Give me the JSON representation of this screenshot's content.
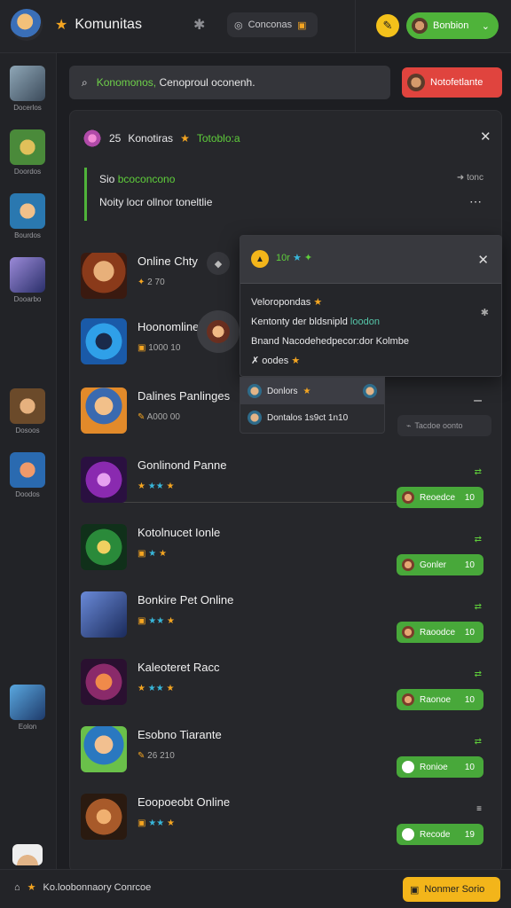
{
  "header": {
    "title": "Komunitas",
    "chip_label": "Conconas",
    "user_label": "Bonbion"
  },
  "search": {
    "highlight": "Konomonos,",
    "text": "Cenoproul oconenh."
  },
  "notif_button": {
    "label": "Notofetlante"
  },
  "panel": {
    "head_count": "25",
    "head_title": "Konotiras",
    "head_green": "Totoblo:a",
    "notice_prefix": "Sio",
    "notice_green": "bcoconcono",
    "notice_right": "tonc",
    "notice_line2": "Noity locr ollnor toneltlie"
  },
  "popup": {
    "title": "10r",
    "line1": "Veloropondas",
    "line2_prefix": "Kentonty der bldsnipld",
    "line2_green": "loodon",
    "line3": "Bnand Nacodehedpecor:dor Kolmbe",
    "line4": "oodes",
    "sub1": "Donlors",
    "sub2": "Dontalos 1s9ct 1n10"
  },
  "tag_gray": {
    "label": "Tacdoe oonto"
  },
  "rows": [
    {
      "title": "Online Chty",
      "meta": "2 70"
    },
    {
      "title": "Hoonomline",
      "meta": "1000 10"
    },
    {
      "title": "Dalines Panlinges",
      "meta": "A000 00"
    },
    {
      "title": "Gonlinond Panne",
      "pill": "Reoedce",
      "pill_num": "10"
    },
    {
      "title": "Kotolnucet Ionle",
      "pill": "Gonler",
      "pill_num": "10"
    },
    {
      "title": "Bonkire Pet Online",
      "pill": "Raoodce",
      "pill_num": "10"
    },
    {
      "title": "Kaleoteret Racc",
      "pill": "Raonoe",
      "pill_num": "10"
    },
    {
      "title": "Esobno Tiarante",
      "meta": "26 210",
      "pill": "Ronioe",
      "pill_num": "10"
    },
    {
      "title": "Eoopoeobt Online",
      "pill": "Recode",
      "pill_num": "19"
    }
  ],
  "sidebar": {
    "items": [
      "Docerlos",
      "Doordos",
      "Bourdos",
      "Dooarbo",
      "Dosoos",
      "Doodos",
      "Eolon"
    ]
  },
  "bottom": {
    "text": "Ko.loobonnaory Conrcoe",
    "button": "Nonmer Sorio"
  },
  "colors": {
    "accent_green": "#4fb33a",
    "danger_red": "#e0443e",
    "warning_yellow": "#f3b51a"
  }
}
